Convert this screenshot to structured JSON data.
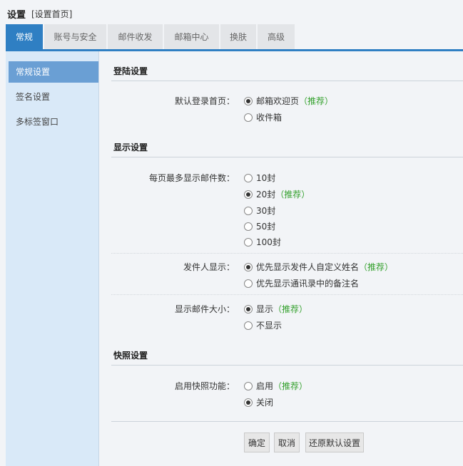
{
  "header": {
    "title": "设置",
    "crumb": "[设置首页]"
  },
  "tabs": [
    {
      "label": "常规",
      "active": true
    },
    {
      "label": "账号与安全",
      "active": false
    },
    {
      "label": "邮件收发",
      "active": false
    },
    {
      "label": "邮箱中心",
      "active": false
    },
    {
      "label": "换肤",
      "active": false
    },
    {
      "label": "高级",
      "active": false
    }
  ],
  "sidebar": {
    "items": [
      {
        "label": "常规设置",
        "active": true
      },
      {
        "label": "签名设置",
        "active": false
      },
      {
        "label": "多标签窗口",
        "active": false
      }
    ]
  },
  "login": {
    "section_title": "登陆设置",
    "label": "默认登录首页：",
    "options": [
      {
        "text": "邮箱欢迎页",
        "recommend": "（推荐）",
        "checked": true
      },
      {
        "text": "收件箱",
        "recommend": "",
        "checked": false
      }
    ]
  },
  "display": {
    "section_title": "显示设置",
    "per_page": {
      "label": "每页最多显示邮件数：",
      "options": [
        {
          "text": "10封",
          "recommend": "",
          "checked": false
        },
        {
          "text": "20封",
          "recommend": "（推荐）",
          "checked": true
        },
        {
          "text": "30封",
          "recommend": "",
          "checked": false
        },
        {
          "text": "50封",
          "recommend": "",
          "checked": false
        },
        {
          "text": "100封",
          "recommend": "",
          "checked": false
        }
      ]
    },
    "sender": {
      "label": "发件人显示：",
      "options": [
        {
          "text": "优先显示发件人自定义姓名",
          "recommend": "（推荐）",
          "checked": true
        },
        {
          "text": "优先显示通讯录中的备注名",
          "recommend": "",
          "checked": false
        }
      ]
    },
    "size": {
      "label": "显示邮件大小：",
      "options": [
        {
          "text": "显示",
          "recommend": "（推荐）",
          "checked": true
        },
        {
          "text": "不显示",
          "recommend": "",
          "checked": false
        }
      ]
    }
  },
  "snapshot": {
    "section_title": "快照设置",
    "label": "启用快照功能：",
    "options": [
      {
        "text": "启用",
        "recommend": "（推荐）",
        "checked": false
      },
      {
        "text": "关闭",
        "recommend": "",
        "checked": true
      }
    ]
  },
  "buttons": {
    "ok": "确定",
    "cancel": "取消",
    "reset": "还原默认设置"
  }
}
